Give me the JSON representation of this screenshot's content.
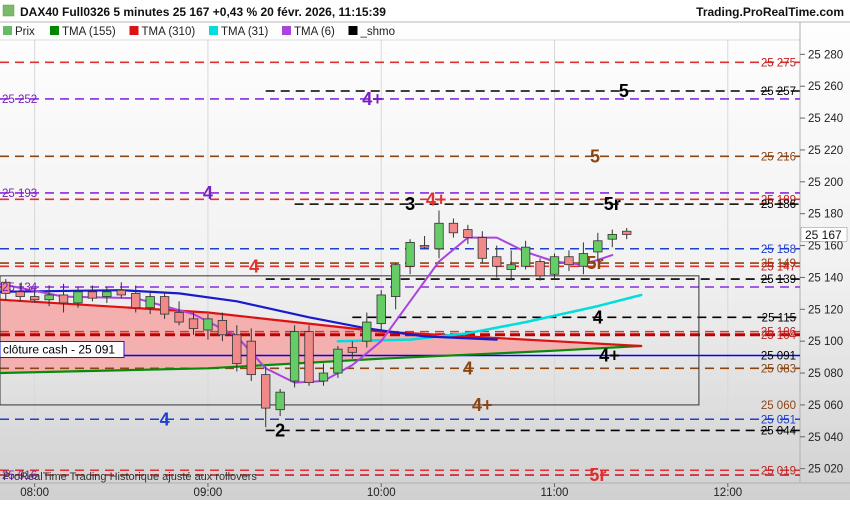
{
  "header": {
    "title": "DAX40 Full0326 5 minutes 25 167 +0,43 % 20 févr. 2026, 11:15:39",
    "brand": "Trading.ProRealTime.com"
  },
  "legend": [
    {
      "label": "Prix",
      "color": "#66bb66"
    },
    {
      "label": "TMA (155)",
      "color": "#008800"
    },
    {
      "label": "TMA (310)",
      "color": "#dd1111"
    },
    {
      "label": "TMA (31)",
      "color": "#00dddd"
    },
    {
      "label": "TMA (6)",
      "color": "#aa44dd"
    },
    {
      "label": "_shmo",
      "color": "#000000"
    }
  ],
  "footer": {
    "text": "ProRealTime Trading  Historique ajusté aux rollovers"
  },
  "cash_box": {
    "label": "clôture cash -  25 091"
  },
  "last_price": {
    "label": "25 167",
    "value": 25167
  },
  "chart_data": {
    "type": "candlestick",
    "y_axis": {
      "ticks": [
        25020,
        25040,
        25060,
        25080,
        25100,
        25120,
        25140,
        25160,
        25180,
        25200,
        25220,
        25240,
        25260,
        25280
      ],
      "min": 25011,
      "max": 25289
    },
    "x_axis": {
      "ticks": [
        {
          "label": "08:00",
          "t": "08:00"
        },
        {
          "label": "09:00",
          "t": "09:00"
        },
        {
          "label": "10:00",
          "t": "10:00"
        },
        {
          "label": "11:00",
          "t": "11:00"
        },
        {
          "label": "12:00",
          "t": "12:00"
        }
      ],
      "range": [
        "07:48",
        "12:25"
      ]
    },
    "levels": [
      {
        "value": 25275,
        "color": "#e03030",
        "label": "25 275",
        "label_color": "#c02020",
        "side": "right",
        "style": "long",
        "from": "start"
      },
      {
        "value": 25257,
        "color": "#000000",
        "label": "25 257",
        "label_color": "#000000",
        "side": "right",
        "style": "long",
        "from": "09:20"
      },
      {
        "value": 25252,
        "color": "#8a2be2",
        "label": "25 252",
        "label_color": "#7a20c0",
        "side": "left",
        "style": "long",
        "from": "start"
      },
      {
        "value": 25216,
        "color": "#8b4513",
        "label": "25 216",
        "label_color": "#8b4513",
        "side": "right",
        "style": "long",
        "from": "start"
      },
      {
        "value": 25193,
        "color": "#8a2be2",
        "label": "25 193",
        "label_color": "#7a20c0",
        "side": "left",
        "style": "long",
        "from": "start"
      },
      {
        "value": 25189,
        "color": "#e03030",
        "label": "25 189",
        "label_color": "#c02020",
        "side": "right",
        "style": "long",
        "from": "start"
      },
      {
        "value": 25186,
        "color": "#000000",
        "label": "25 186",
        "label_color": "#000000",
        "side": "right",
        "style": "long",
        "from": "09:30"
      },
      {
        "value": 25158,
        "color": "#1f3fd0",
        "label": "25 158",
        "label_color": "#1f3fd0",
        "side": "right",
        "style": "long",
        "from": "start"
      },
      {
        "value": 25149,
        "color": "#8b4513",
        "label": "25 149",
        "label_color": "#8b4513",
        "side": "right",
        "style": "long",
        "from": "start"
      },
      {
        "value": 25147,
        "color": "#e03030",
        "label": "25 147",
        "label_color": "#c02020",
        "side": "right",
        "style": "long",
        "from": "start"
      },
      {
        "value": 25139,
        "color": "#000000",
        "label": "25 139",
        "label_color": "#000000",
        "side": "right",
        "style": "long",
        "from": "09:20"
      },
      {
        "value": 25134,
        "color": "#8a2be2",
        "label": "25 134",
        "label_color": "#7a20c0",
        "side": "left",
        "style": "long",
        "from": "start"
      },
      {
        "value": 25115,
        "color": "#000000",
        "label": "25 115",
        "label_color": "#000000",
        "side": "right",
        "style": "long",
        "from": "09:50"
      },
      {
        "value": 25106,
        "color": "#e03030",
        "label": "25 106",
        "label_color": "#c02020",
        "side": "right",
        "style": "long",
        "from": "start"
      },
      {
        "value": 25104,
        "color": "#c00000",
        "label": "25 104",
        "label_color": "#c02020",
        "side": "right",
        "style": "thick",
        "from": "start"
      },
      {
        "value": 25091,
        "color": "#0000ff",
        "label": "25 091",
        "label_color": "#000000",
        "side": "right",
        "style": "solid",
        "from": "start"
      },
      {
        "value": 25083,
        "color": "#8b4513",
        "label": "25 083",
        "label_color": "#8b4513",
        "side": "right",
        "style": "long",
        "from": "start"
      },
      {
        "value": 25060,
        "color": "#000000",
        "label": "25 060",
        "label_color": "#8b4513",
        "side": "right",
        "style": "none",
        "from": "start"
      },
      {
        "value": 25051,
        "color": "#1f3fd0",
        "label": "25 051",
        "label_color": "#1f3fd0",
        "side": "right",
        "style": "long",
        "from": "start"
      },
      {
        "value": 25044,
        "color": "#000000",
        "label": "25 044",
        "label_color": "#000000",
        "side": "right",
        "style": "long",
        "from": "09:20"
      },
      {
        "value": 25019,
        "color": "#e03030",
        "label": "25 019",
        "label_color": "#c02020",
        "side": "right",
        "style": "long",
        "from": "start"
      },
      {
        "value": 25016,
        "color": "#8a2be2",
        "label": "25 016",
        "label_color": "#7a20c0",
        "side": "left",
        "style": "long",
        "from": "start"
      },
      {
        "value": 25016,
        "color": "#e03030",
        "label": "",
        "label_color": "#c02020",
        "side": "right",
        "style": "long",
        "from": "start"
      }
    ],
    "level_marks": [
      {
        "text": "4+",
        "t": "09:57",
        "value": 25252,
        "color": "#7a20c0"
      },
      {
        "text": "5",
        "t": "11:24",
        "value": 25257,
        "color": "#000000"
      },
      {
        "text": "5",
        "t": "11:14",
        "value": 25216,
        "color": "#8b4513"
      },
      {
        "text": "4",
        "t": "09:00",
        "value": 25193,
        "color": "#7a20c0"
      },
      {
        "text": "3",
        "t": "10:10",
        "value": 25186,
        "color": "#000000"
      },
      {
        "text": "4+",
        "t": "10:19",
        "value": 25189,
        "color": "#e03030"
      },
      {
        "text": "5r",
        "t": "11:20",
        "value": 25186,
        "color": "#000000"
      },
      {
        "text": "4",
        "t": "09:16",
        "value": 25147,
        "color": "#e03030"
      },
      {
        "text": "5r",
        "t": "11:14",
        "value": 25149,
        "color": "#8b4513"
      },
      {
        "text": "4",
        "t": "11:15",
        "value": 25115,
        "color": "#000000"
      },
      {
        "text": "4+",
        "t": "11:19",
        "value": 25091,
        "color": "#000000"
      },
      {
        "text": "4",
        "t": "10:30",
        "value": 25083,
        "color": "#8b4513"
      },
      {
        "text": "4+",
        "t": "10:35",
        "value": 25060,
        "color": "#8b4513"
      },
      {
        "text": "4",
        "t": "08:45",
        "value": 25051,
        "color": "#1f3fd0"
      },
      {
        "text": "2",
        "t": "09:25",
        "value": 25044,
        "color": "#000000"
      },
      {
        "text": "5r",
        "t": "11:15",
        "value": 25016,
        "color": "#e03030"
      }
    ],
    "candles": [
      {
        "t": "07:50",
        "o": 25137,
        "h": 25139,
        "l": 25126,
        "c": 25130
      },
      {
        "t": "07:55",
        "o": 25131,
        "h": 25136,
        "l": 25125,
        "c": 25128
      },
      {
        "t": "08:00",
        "o": 25128,
        "h": 25133,
        "l": 25124,
        "c": 25126
      },
      {
        "t": "08:05",
        "o": 25126,
        "h": 25135,
        "l": 25122,
        "c": 25129
      },
      {
        "t": "08:10",
        "o": 25129,
        "h": 25136,
        "l": 25118,
        "c": 25124
      },
      {
        "t": "08:15",
        "o": 25124,
        "h": 25134,
        "l": 25121,
        "c": 25131
      },
      {
        "t": "08:20",
        "o": 25131,
        "h": 25135,
        "l": 25125,
        "c": 25127
      },
      {
        "t": "08:25",
        "o": 25128,
        "h": 25134,
        "l": 25124,
        "c": 25131
      },
      {
        "t": "08:30",
        "o": 25132,
        "h": 25137,
        "l": 25127,
        "c": 25129
      },
      {
        "t": "08:35",
        "o": 25130,
        "h": 25135,
        "l": 25118,
        "c": 25121
      },
      {
        "t": "08:40",
        "o": 25121,
        "h": 25131,
        "l": 25117,
        "c": 25128
      },
      {
        "t": "08:45",
        "o": 25128,
        "h": 25131,
        "l": 25114,
        "c": 25117
      },
      {
        "t": "08:50",
        "o": 25118,
        "h": 25125,
        "l": 25110,
        "c": 25112
      },
      {
        "t": "08:55",
        "o": 25114,
        "h": 25118,
        "l": 25104,
        "c": 25108
      },
      {
        "t": "09:00",
        "o": 25107,
        "h": 25117,
        "l": 25101,
        "c": 25114
      },
      {
        "t": "09:05",
        "o": 25113,
        "h": 25118,
        "l": 25100,
        "c": 25104
      },
      {
        "t": "09:10",
        "o": 25104,
        "h": 25110,
        "l": 25081,
        "c": 25086
      },
      {
        "t": "09:15",
        "o": 25100,
        "h": 25108,
        "l": 25075,
        "c": 25079
      },
      {
        "t": "09:20",
        "o": 25079,
        "h": 25084,
        "l": 25046,
        "c": 25058
      },
      {
        "t": "09:25",
        "o": 25057,
        "h": 25070,
        "l": 25053,
        "c": 25068
      },
      {
        "t": "09:30",
        "o": 25075,
        "h": 25110,
        "l": 25071,
        "c": 25106
      },
      {
        "t": "09:35",
        "o": 25106,
        "h": 25110,
        "l": 25072,
        "c": 25074
      },
      {
        "t": "09:40",
        "o": 25075,
        "h": 25086,
        "l": 25072,
        "c": 25080
      },
      {
        "t": "09:45",
        "o": 25080,
        "h": 25097,
        "l": 25077,
        "c": 25095
      },
      {
        "t": "09:50",
        "o": 25096,
        "h": 25100,
        "l": 25089,
        "c": 25093
      },
      {
        "t": "09:55",
        "o": 25100,
        "h": 25118,
        "l": 25096,
        "c": 25112
      },
      {
        "t": "10:00",
        "o": 25111,
        "h": 25132,
        "l": 25107,
        "c": 25129
      },
      {
        "t": "10:05",
        "o": 25128,
        "h": 25149,
        "l": 25120,
        "c": 25148
      },
      {
        "t": "10:10",
        "o": 25147,
        "h": 25164,
        "l": 25142,
        "c": 25162
      },
      {
        "t": "10:15",
        "o": 25160,
        "h": 25166,
        "l": 25158,
        "c": 25159
      },
      {
        "t": "10:20",
        "o": 25158,
        "h": 25182,
        "l": 25152,
        "c": 25174
      },
      {
        "t": "10:25",
        "o": 25174,
        "h": 25177,
        "l": 25165,
        "c": 25168
      },
      {
        "t": "10:30",
        "o": 25170,
        "h": 25173,
        "l": 25161,
        "c": 25165
      },
      {
        "t": "10:35",
        "o": 25165,
        "h": 25169,
        "l": 25149,
        "c": 25152
      },
      {
        "t": "10:40",
        "o": 25153,
        "h": 25160,
        "l": 25140,
        "c": 25147
      },
      {
        "t": "10:45",
        "o": 25145,
        "h": 25157,
        "l": 25138,
        "c": 25148
      },
      {
        "t": "10:50",
        "o": 25147,
        "h": 25163,
        "l": 25145,
        "c": 25159
      },
      {
        "t": "10:55",
        "o": 25150,
        "h": 25152,
        "l": 25138,
        "c": 25141
      },
      {
        "t": "11:00",
        "o": 25142,
        "h": 25155,
        "l": 25139,
        "c": 25153
      },
      {
        "t": "11:05",
        "o": 25153,
        "h": 25157,
        "l": 25144,
        "c": 25148
      },
      {
        "t": "11:10",
        "o": 25147,
        "h": 25162,
        "l": 25142,
        "c": 25155
      },
      {
        "t": "11:15",
        "o": 25156,
        "h": 25168,
        "l": 25150,
        "c": 25163
      },
      {
        "t": "11:20",
        "o": 25164,
        "h": 25170,
        "l": 25159,
        "c": 25167
      },
      {
        "t": "11:25",
        "o": 25169,
        "h": 25171,
        "l": 25164,
        "c": 25167
      }
    ],
    "series": [
      {
        "name": "TMA (155)",
        "color": "#0a8a0a",
        "width": 2.2,
        "points": [
          [
            "07:48",
            25080
          ],
          [
            "09:00",
            25083
          ],
          [
            "10:00",
            25089
          ],
          [
            "11:00",
            25094
          ],
          [
            "11:30",
            25097
          ]
        ]
      },
      {
        "name": "TMA (310)",
        "color": "#dd1111",
        "width": 2.2,
        "points": [
          [
            "07:48",
            25126
          ],
          [
            "09:00",
            25118
          ],
          [
            "10:00",
            25106
          ],
          [
            "11:00",
            25100
          ],
          [
            "11:30",
            25097
          ]
        ]
      },
      {
        "name": "TMA (31)",
        "color": "#00dddd",
        "width": 2.5,
        "points": [
          [
            "09:45",
            25100
          ],
          [
            "10:10",
            25101
          ],
          [
            "10:30",
            25105
          ],
          [
            "10:50",
            25112
          ],
          [
            "11:15",
            25122
          ],
          [
            "11:30",
            25129
          ]
        ]
      },
      {
        "name": "",
        "color": "#1a1acc",
        "width": 2.2,
        "points": [
          [
            "07:48",
            25131
          ],
          [
            "08:30",
            25132
          ],
          [
            "08:50",
            25130
          ],
          [
            "09:10",
            25125
          ],
          [
            "09:35",
            25115
          ],
          [
            "09:55",
            25108
          ],
          [
            "10:15",
            25103
          ],
          [
            "10:40",
            25101
          ]
        ]
      },
      {
        "name": "TMA (6)",
        "color": "#aa44dd",
        "width": 2,
        "points": [
          [
            "07:48",
            25136
          ],
          [
            "08:10",
            25128
          ],
          [
            "08:35",
            25127
          ],
          [
            "08:55",
            25117
          ],
          [
            "09:10",
            25103
          ],
          [
            "09:20",
            25083
          ],
          [
            "09:30",
            25074
          ],
          [
            "09:40",
            25075
          ],
          [
            "09:50",
            25085
          ],
          [
            "10:00",
            25100
          ],
          [
            "10:10",
            25125
          ],
          [
            "10:20",
            25150
          ],
          [
            "10:30",
            25165
          ],
          [
            "10:40",
            25165
          ],
          [
            "10:50",
            25156
          ],
          [
            "11:00",
            25150
          ],
          [
            "11:10",
            25148
          ],
          [
            "11:20",
            25154
          ]
        ]
      }
    ],
    "band": {
      "color": "#f5a8a8",
      "from": "07:48",
      "to": "11:30"
    },
    "box": {
      "t0": "07:48",
      "t1": "11:50",
      "v_top": 25141,
      "v_bottom": 25060
    }
  }
}
